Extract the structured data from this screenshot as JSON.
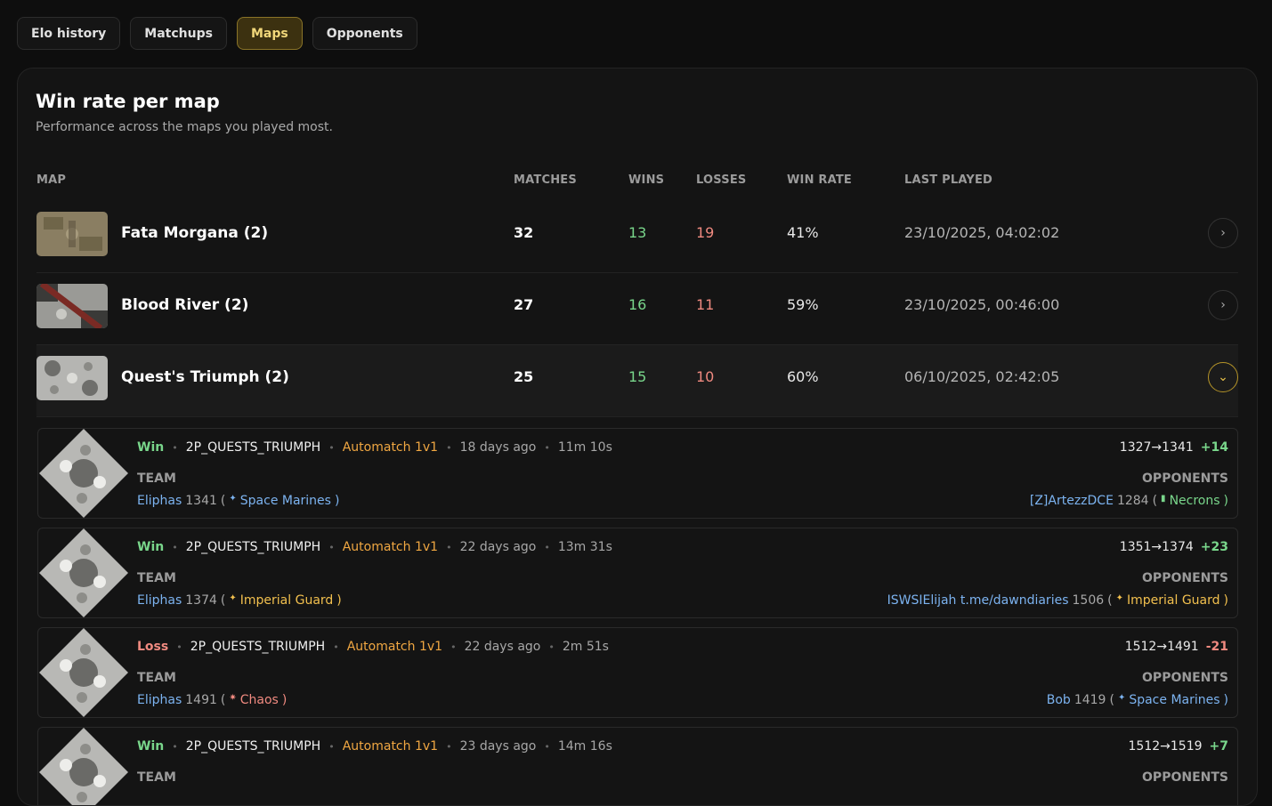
{
  "tabs": [
    "Elo history",
    "Matchups",
    "Maps",
    "Opponents"
  ],
  "card": {
    "title": "Win rate per map",
    "subtitle": "Performance across the maps you played most."
  },
  "columns": {
    "map": "MAP",
    "matches": "MATCHES",
    "wins": "WINS",
    "losses": "LOSSES",
    "win_rate": "WIN RATE",
    "last_played": "LAST PLAYED"
  },
  "maps": [
    {
      "name": "Fata Morgana (2)",
      "matches": "32",
      "wins": "13",
      "losses": "19",
      "win_rate": "41%",
      "last_played": "23/10/2025, 04:02:02"
    },
    {
      "name": "Blood River (2)",
      "matches": "27",
      "wins": "16",
      "losses": "11",
      "win_rate": "59%",
      "last_played": "23/10/2025, 00:46:00"
    },
    {
      "name": "Quest's Triumph (2)",
      "matches": "25",
      "wins": "15",
      "losses": "10",
      "win_rate": "60%",
      "last_played": "06/10/2025, 02:42:05"
    }
  ],
  "labels": {
    "team": "TEAM",
    "opponents": "OPPONENTS",
    "sep": "•"
  },
  "matches": [
    {
      "result": "Win",
      "map": "2P_QUESTS_TRIUMPH",
      "mode": "Automatch 1v1",
      "age": "18 days ago",
      "duration": "11m 10s",
      "elo_change": "1327→1341",
      "delta": "+14",
      "team_player": "Eliphas",
      "team_elo": "1341",
      "team_faction": "Space Marines",
      "opp_player": "[Z]ArtezzDCE",
      "opp_elo": "1284",
      "opp_faction": "Necrons"
    },
    {
      "result": "Win",
      "map": "2P_QUESTS_TRIUMPH",
      "mode": "Automatch 1v1",
      "age": "22 days ago",
      "duration": "13m 31s",
      "elo_change": "1351→1374",
      "delta": "+23",
      "team_player": "Eliphas",
      "team_elo": "1374",
      "team_faction": "Imperial Guard",
      "opp_player": "ISWSIElijah t.me/dawndiaries",
      "opp_elo": "1506",
      "opp_faction": "Imperial Guard"
    },
    {
      "result": "Loss",
      "map": "2P_QUESTS_TRIUMPH",
      "mode": "Automatch 1v1",
      "age": "22 days ago",
      "duration": "2m 51s",
      "elo_change": "1512→1491",
      "delta": "-21",
      "team_player": "Eliphas",
      "team_elo": "1491",
      "team_faction": "Chaos",
      "opp_player": "Bob",
      "opp_elo": "1419",
      "opp_faction": "Space Marines"
    },
    {
      "result": "Win",
      "map": "2P_QUESTS_TRIUMPH",
      "mode": "Automatch 1v1",
      "age": "23 days ago",
      "duration": "14m 16s",
      "elo_change": "1512→1519",
      "delta": "+7",
      "team_player": "",
      "team_elo": "",
      "team_faction": "",
      "opp_player": "",
      "opp_elo": "",
      "opp_faction": ""
    }
  ]
}
